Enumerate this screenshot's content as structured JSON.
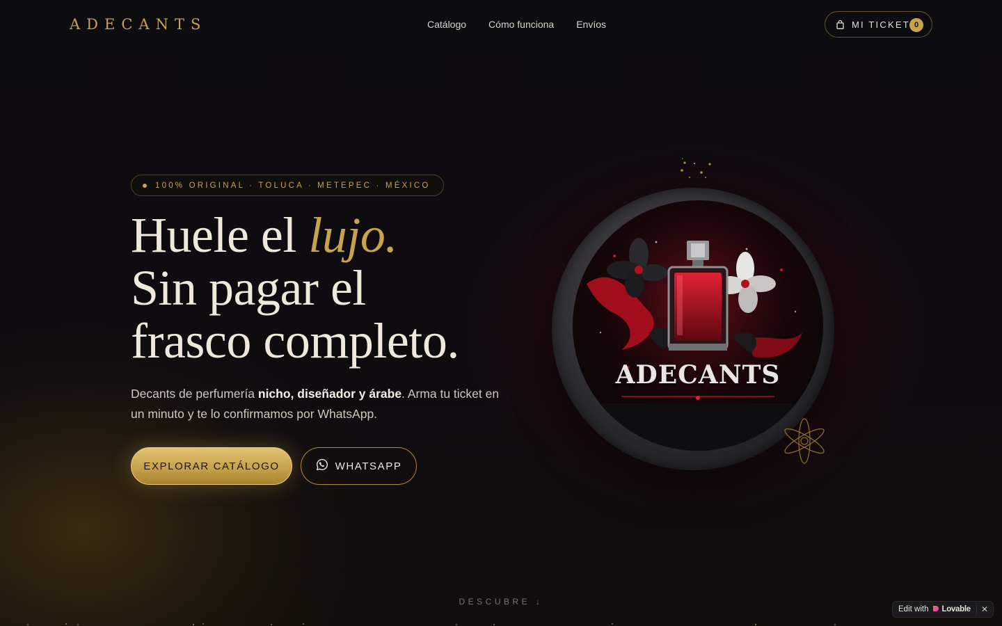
{
  "brand": {
    "logo_text": "ADECANTS",
    "accent_color": "#c9a24c",
    "wine_color": "#7a0c1c"
  },
  "nav": {
    "items": [
      {
        "label": "Catálogo"
      },
      {
        "label": "Cómo funciona"
      },
      {
        "label": "Envíos"
      }
    ]
  },
  "ticket": {
    "label": "MI TICKET",
    "count": "0",
    "icon": "shopping-bag-icon"
  },
  "hero": {
    "badge": "100% ORIGINAL · TOLUCA · METEPEC · MÉXICO",
    "headline": {
      "line1_pre": "Huele el ",
      "line1_accent": "lujo.",
      "line2": "Sin pagar el",
      "line3": "frasco completo."
    },
    "lead": {
      "pre": "Decants de perfumería ",
      "bold": "nicho, diseñador y árabe",
      "post": ". Arma tu ticket en un minuto y te lo confirmamos por WhatsApp."
    },
    "primary_cta": "EXPLORAR CATÁLOGO",
    "secondary_cta": "WHATSAPP",
    "secondary_icon": "whatsapp-icon",
    "emblem_text": "ADECANTS"
  },
  "discover": {
    "label": "DESCUBRE ↓"
  },
  "lovable_badge": {
    "prefix": "Edit with",
    "brand": "Lovable",
    "close": "✕"
  }
}
